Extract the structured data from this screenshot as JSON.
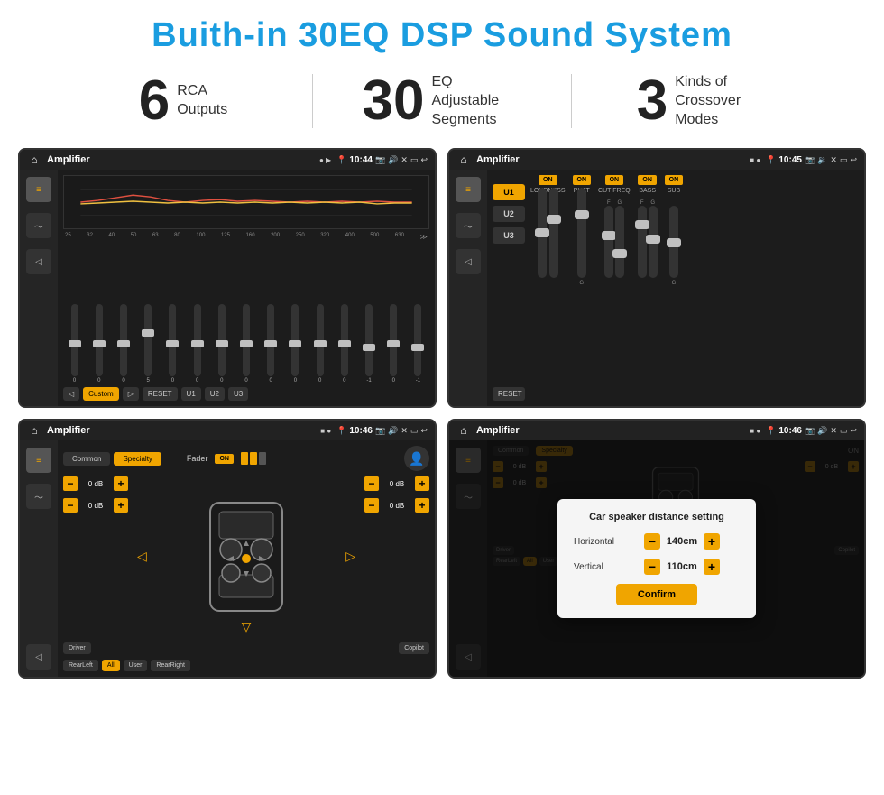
{
  "page": {
    "title": "Buith-in 30EQ DSP Sound System"
  },
  "stats": [
    {
      "number": "6",
      "text": "RCA\nOutputs"
    },
    {
      "number": "30",
      "text": "EQ Adjustable\nSegments"
    },
    {
      "number": "3",
      "text": "Kinds of\nCrossover Modes"
    }
  ],
  "screens": [
    {
      "id": "eq-screen",
      "title": "Amplifier",
      "time": "10:44",
      "type": "eq"
    },
    {
      "id": "amp-screen",
      "title": "Amplifier",
      "time": "10:45",
      "type": "amplifier"
    },
    {
      "id": "speaker-screen",
      "title": "Amplifier",
      "time": "10:46",
      "type": "speaker"
    },
    {
      "id": "dialog-screen",
      "title": "Amplifier",
      "time": "10:46",
      "type": "dialog"
    }
  ],
  "eq": {
    "frequencies": [
      "25",
      "32",
      "40",
      "50",
      "63",
      "80",
      "100",
      "125",
      "160",
      "200",
      "250",
      "320",
      "400",
      "500",
      "630"
    ],
    "values": [
      "0",
      "0",
      "0",
      "5",
      "0",
      "0",
      "0",
      "0",
      "0",
      "0",
      "0",
      "0",
      "-1",
      "0",
      "-1"
    ],
    "preset": "Custom",
    "buttons": [
      "RESET",
      "U1",
      "U2",
      "U3"
    ]
  },
  "amplifier": {
    "presets": [
      "U1",
      "U2",
      "U3"
    ],
    "controls": [
      "LOUDNESS",
      "PHAT",
      "CUT FREQ",
      "BASS",
      "SUB"
    ],
    "reset": "RESET"
  },
  "speaker": {
    "tabs": [
      "Common",
      "Specialty"
    ],
    "fader": "Fader",
    "fader_on": "ON",
    "buttons": [
      "Driver",
      "Copilot",
      "RearLeft",
      "All",
      "User",
      "RearRight"
    ],
    "db_values": [
      "0 dB",
      "0 dB",
      "0 dB",
      "0 dB"
    ]
  },
  "dialog": {
    "title": "Car speaker distance setting",
    "horizontal_label": "Horizontal",
    "horizontal_value": "140cm",
    "vertical_label": "Vertical",
    "vertical_value": "110cm",
    "confirm": "Confirm",
    "tabs": [
      "Common",
      "Specialty"
    ],
    "db_values": [
      "0 dB",
      "0 dB"
    ],
    "bottom_buttons": [
      "Driver",
      "Copilot",
      "RearLeft",
      "All",
      "User",
      "RearRight"
    ]
  },
  "colors": {
    "accent": "#f0a500",
    "blue": "#1a9de0",
    "dark_bg": "#1c1c1c",
    "sidebar_bg": "#252525"
  }
}
